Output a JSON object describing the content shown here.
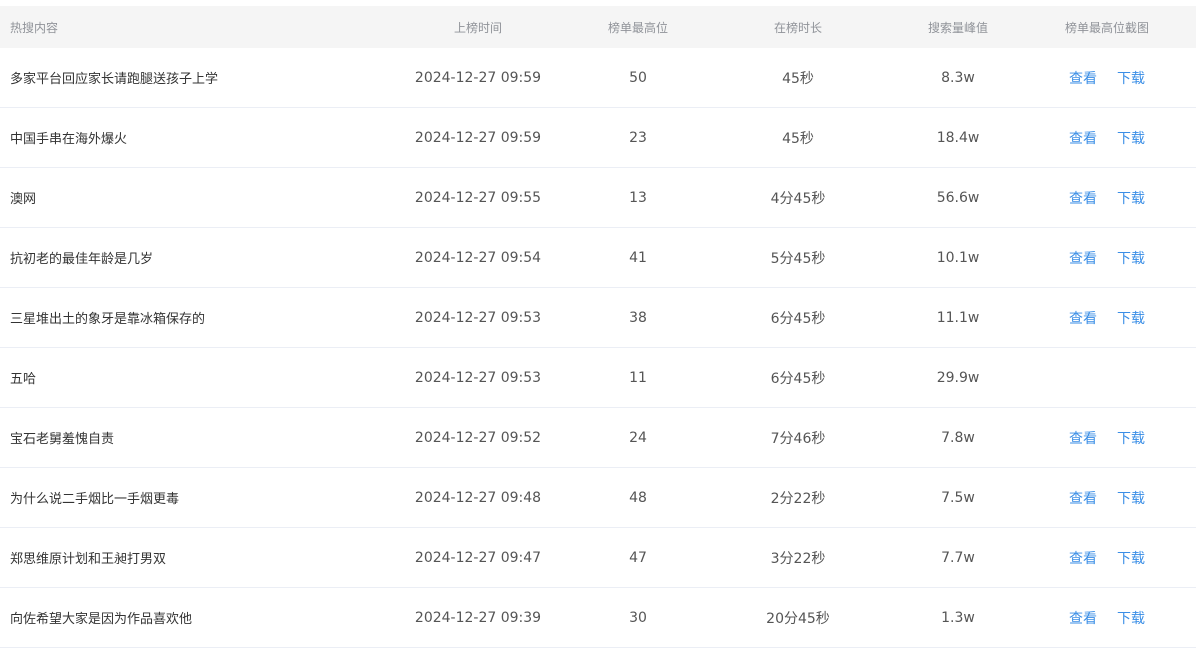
{
  "table": {
    "headers": {
      "title": "热搜内容",
      "time": "上榜时间",
      "rank": "榜单最高位",
      "duration": "在榜时长",
      "peak": "搜索量峰值",
      "screenshot": "榜单最高位截图"
    },
    "view_label": "查看",
    "download_label": "下载",
    "link_color": "#3a8ee6",
    "rows": [
      {
        "title": "多家平台回应家长请跑腿送孩子上学",
        "time": "2024-12-27 09:59",
        "rank": "50",
        "duration": "45秒",
        "peak": "8.3w",
        "has_screenshot": true
      },
      {
        "title": "中国手串在海外爆火",
        "time": "2024-12-27 09:59",
        "rank": "23",
        "duration": "45秒",
        "peak": "18.4w",
        "has_screenshot": true
      },
      {
        "title": "澳网",
        "time": "2024-12-27 09:55",
        "rank": "13",
        "duration": "4分45秒",
        "peak": "56.6w",
        "has_screenshot": true
      },
      {
        "title": "抗初老的最佳年龄是几岁",
        "time": "2024-12-27 09:54",
        "rank": "41",
        "duration": "5分45秒",
        "peak": "10.1w",
        "has_screenshot": true
      },
      {
        "title": "三星堆出土的象牙是靠冰箱保存的",
        "time": "2024-12-27 09:53",
        "rank": "38",
        "duration": "6分45秒",
        "peak": "11.1w",
        "has_screenshot": true
      },
      {
        "title": "五哈",
        "time": "2024-12-27 09:53",
        "rank": "11",
        "duration": "6分45秒",
        "peak": "29.9w",
        "has_screenshot": false
      },
      {
        "title": "宝石老舅羞愧自责",
        "time": "2024-12-27 09:52",
        "rank": "24",
        "duration": "7分46秒",
        "peak": "7.8w",
        "has_screenshot": true
      },
      {
        "title": "为什么说二手烟比一手烟更毒",
        "time": "2024-12-27 09:48",
        "rank": "48",
        "duration": "2分22秒",
        "peak": "7.5w",
        "has_screenshot": true
      },
      {
        "title": "郑思维原计划和王昶打男双",
        "time": "2024-12-27 09:47",
        "rank": "47",
        "duration": "3分22秒",
        "peak": "7.7w",
        "has_screenshot": true
      },
      {
        "title": "向佐希望大家是因为作品喜欢他",
        "time": "2024-12-27 09:39",
        "rank": "30",
        "duration": "20分45秒",
        "peak": "1.3w",
        "has_screenshot": true
      }
    ]
  }
}
